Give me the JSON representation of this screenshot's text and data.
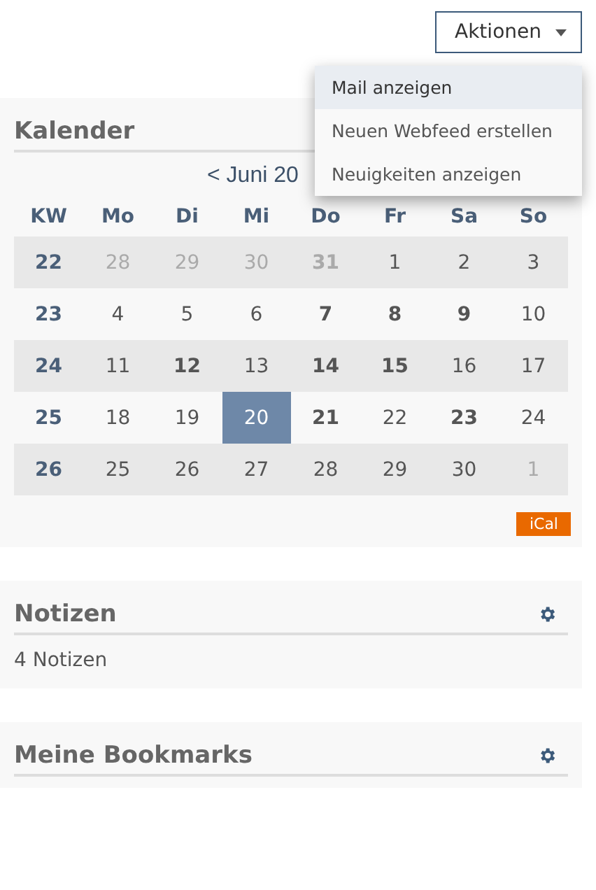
{
  "actions_button": {
    "label": "Aktionen"
  },
  "actions_menu": [
    {
      "label": "Mail anzeigen",
      "selected": true
    },
    {
      "label": "Neuen Webfeed erstellen",
      "selected": false
    },
    {
      "label": "Neuigkeiten anzeigen",
      "selected": false
    }
  ],
  "calendar": {
    "title": "Kalender",
    "month_nav": "< Juni 20",
    "columns": [
      "KW",
      "Mo",
      "Di",
      "Mi",
      "Do",
      "Fr",
      "Sa",
      "So"
    ],
    "weeks": [
      {
        "week": "22",
        "days": [
          {
            "label": "28",
            "kind": "other"
          },
          {
            "label": "29",
            "kind": "other"
          },
          {
            "label": "30",
            "kind": "other"
          },
          {
            "label": "31",
            "kind": "other-event"
          },
          {
            "label": "1",
            "kind": "day"
          },
          {
            "label": "2",
            "kind": "day"
          },
          {
            "label": "3",
            "kind": "day"
          }
        ]
      },
      {
        "week": "23",
        "days": [
          {
            "label": "4",
            "kind": "day"
          },
          {
            "label": "5",
            "kind": "day"
          },
          {
            "label": "6",
            "kind": "day"
          },
          {
            "label": "7",
            "kind": "event"
          },
          {
            "label": "8",
            "kind": "event"
          },
          {
            "label": "9",
            "kind": "event"
          },
          {
            "label": "10",
            "kind": "day"
          }
        ]
      },
      {
        "week": "24",
        "days": [
          {
            "label": "11",
            "kind": "day"
          },
          {
            "label": "12",
            "kind": "event"
          },
          {
            "label": "13",
            "kind": "day"
          },
          {
            "label": "14",
            "kind": "event"
          },
          {
            "label": "15",
            "kind": "event"
          },
          {
            "label": "16",
            "kind": "day"
          },
          {
            "label": "17",
            "kind": "day"
          }
        ]
      },
      {
        "week": "25",
        "days": [
          {
            "label": "18",
            "kind": "day"
          },
          {
            "label": "19",
            "kind": "day"
          },
          {
            "label": "20",
            "kind": "today"
          },
          {
            "label": "21",
            "kind": "event"
          },
          {
            "label": "22",
            "kind": "day"
          },
          {
            "label": "23",
            "kind": "event"
          },
          {
            "label": "24",
            "kind": "day"
          }
        ]
      },
      {
        "week": "26",
        "days": [
          {
            "label": "25",
            "kind": "day"
          },
          {
            "label": "26",
            "kind": "day"
          },
          {
            "label": "27",
            "kind": "day"
          },
          {
            "label": "28",
            "kind": "day"
          },
          {
            "label": "29",
            "kind": "day"
          },
          {
            "label": "30",
            "kind": "day"
          },
          {
            "label": "1",
            "kind": "other"
          }
        ]
      }
    ],
    "ical_button": "iCal"
  },
  "notes": {
    "title": "Notizen",
    "summary": "4 Notizen"
  },
  "bookmarks": {
    "title": "Meine Bookmarks"
  }
}
